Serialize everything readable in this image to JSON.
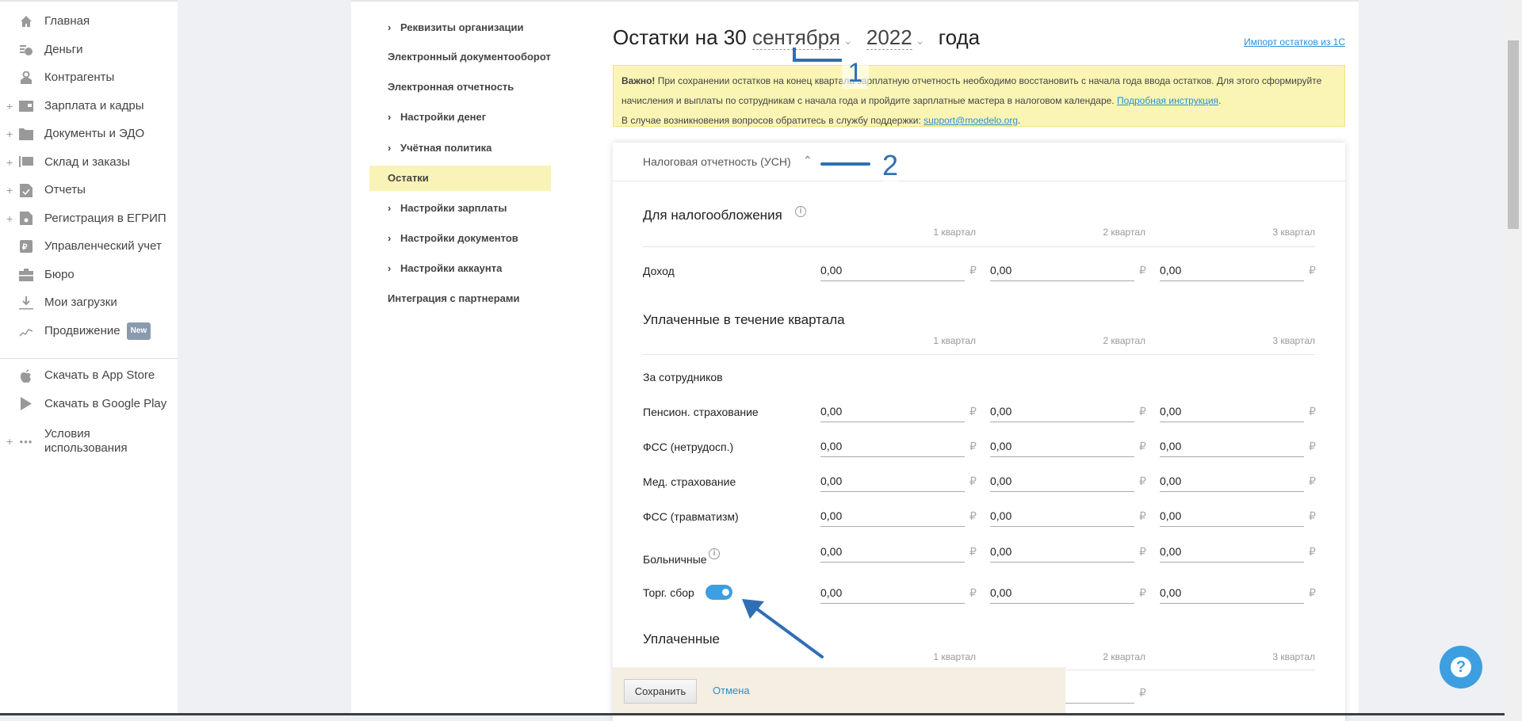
{
  "sidebar": {
    "items": [
      {
        "label": "Главная",
        "icon": "home-icon",
        "plus": false
      },
      {
        "label": "Деньги",
        "icon": "money-icon",
        "plus": false
      },
      {
        "label": "Контрагенты",
        "icon": "contractors-icon",
        "plus": false
      },
      {
        "label": "Зарплата и кадры",
        "icon": "wallet-icon",
        "plus": true
      },
      {
        "label": "Документы и ЭДО",
        "icon": "folder-icon",
        "plus": true
      },
      {
        "label": "Склад и заказы",
        "icon": "warehouse-icon",
        "plus": true
      },
      {
        "label": "Отчеты",
        "icon": "report-icon",
        "plus": true
      },
      {
        "label": "Регистрация в ЕГРИП",
        "icon": "registration-icon",
        "plus": true
      },
      {
        "label": "Управленческий учет",
        "icon": "management-icon",
        "plus": false
      },
      {
        "label": "Бюро",
        "icon": "briefcase-icon",
        "plus": false
      },
      {
        "label": "Мои загрузки",
        "icon": "download-icon",
        "plus": false
      },
      {
        "label": "Продвижение",
        "icon": "promotion-icon",
        "plus": false,
        "badge": "New"
      }
    ],
    "bottom": [
      {
        "label": "Скачать в App Store",
        "icon": "apple-icon"
      },
      {
        "label": "Скачать в Google Play",
        "icon": "google-play-icon"
      },
      {
        "label1": "Условия",
        "label2": "использования",
        "icon": "more-icon"
      }
    ],
    "plus_glyph": "+"
  },
  "settings_menu": [
    {
      "label": "Реквизиты организации",
      "chevron": true
    },
    {
      "label": "Электронный документооборот",
      "chevron": false
    },
    {
      "label": "Электронная отчетность",
      "chevron": false
    },
    {
      "label": "Настройки денег",
      "chevron": true
    },
    {
      "label": "Учётная политика",
      "chevron": true
    },
    {
      "label": "Остатки",
      "chevron": false,
      "active": true
    },
    {
      "label": "Настройки зарплаты",
      "chevron": true
    },
    {
      "label": "Настройки документов",
      "chevron": true
    },
    {
      "label": "Настройки аккаунта",
      "chevron": true
    },
    {
      "label": "Интеграция с партнерами",
      "chevron": false
    }
  ],
  "header": {
    "title_prefix": "Остатки на 30",
    "month": "сентября",
    "year": "2022",
    "title_suffix": "года",
    "import_link": "Импорт остатков из 1С"
  },
  "notice": {
    "bold": "Важно!",
    "text1": " При сохранении остатков на конец квартала зарплатную отчетность необходимо восстановить с начала года ввода остатков. Для этого сформируйте начисления и выплаты по сотрудникам с начала года и пройдите зарплатные мастера в налоговом календаре. ",
    "link1": "Подробная инструкция",
    "text2": "В случае возникновения вопросов обратитесь в службу поддержки: ",
    "link2": "support@moedelo.org"
  },
  "annotations": {
    "one": "1",
    "two": "2"
  },
  "card": {
    "title": "Налоговая отчетность (УСН)",
    "quarters": [
      "1 квартал",
      "2 квартал",
      "3 квартал"
    ],
    "currency": "₽",
    "section1": "Для налогообложения",
    "income_label": "Доход",
    "income_values": [
      "0,00",
      "0,00",
      "0,00"
    ],
    "section2": "Уплаченные в течение квартала",
    "employees_label": "За сотрудников",
    "rows": [
      {
        "label": "Пенсион. страхование",
        "values": [
          "0,00",
          "0,00",
          "0,00"
        ]
      },
      {
        "label": "ФСС (нетрудосп.)",
        "values": [
          "0,00",
          "0,00",
          "0,00"
        ]
      },
      {
        "label": "Мед. страхование",
        "values": [
          "0,00",
          "0,00",
          "0,00"
        ]
      },
      {
        "label": "ФСС (травматизм)",
        "values": [
          "0,00",
          "0,00",
          "0,00"
        ]
      },
      {
        "label": "Больничные",
        "values": [
          "0,00",
          "0,00",
          "0,00"
        ],
        "info": true
      },
      {
        "label": "Торг. сбор",
        "values": [
          "0,00",
          "0,00",
          "0,00"
        ],
        "toggle": true,
        "toggle_on": true
      }
    ],
    "section3": "Уплаченные"
  },
  "footer": {
    "save": "Сохранить",
    "cancel": "Отмена"
  },
  "help": {
    "glyph": "?"
  },
  "colors": {
    "accent": "#3d9fe0",
    "highlight": "#f9f3b7",
    "notice": "#faf5b5",
    "annotation": "#2f6fb5"
  }
}
